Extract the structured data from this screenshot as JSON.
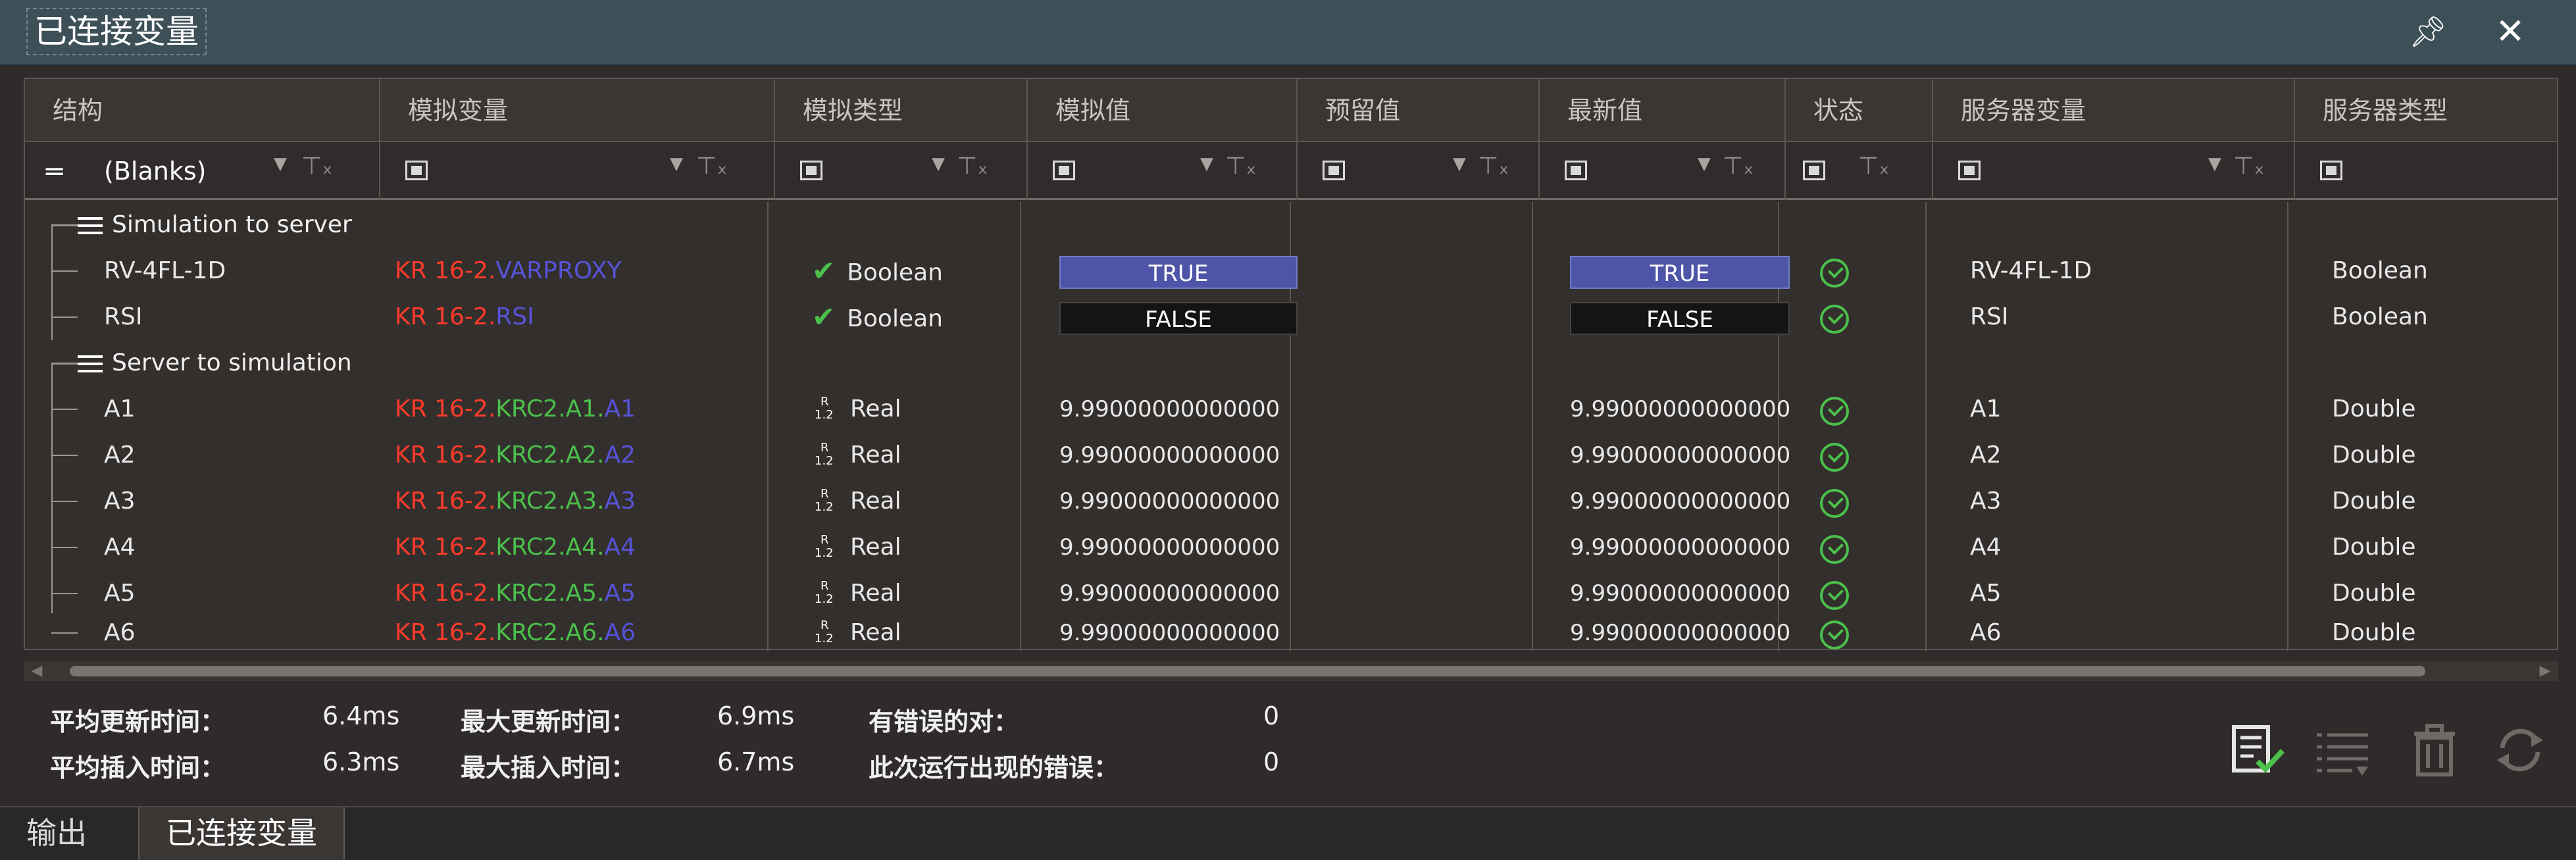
{
  "window": {
    "title": "已连接变量",
    "pin_icon": "pin-icon",
    "close_icon": "close-icon"
  },
  "columns": [
    "结构",
    "模拟变量",
    "模拟类型",
    "模拟值",
    "预留值",
    "最新值",
    "状态",
    "服务器变量",
    "服务器类型"
  ],
  "filter": {
    "structure_value": "(Blanks)"
  },
  "groups": {
    "sim_to_server": "Simulation to server",
    "server_to_sim": "Server to simulation"
  },
  "rows": [
    {
      "name": "RV-4FL-1D",
      "sim_var": [
        "KR 16-2.",
        "",
        "VARPROXY"
      ],
      "sim_type": "Boolean",
      "type_icon": "check",
      "sim_value": "TRUE",
      "latest_value": "TRUE",
      "server_var": "RV-4FL-1D",
      "server_type": "Boolean"
    },
    {
      "name": "RSI",
      "sim_var": [
        "KR 16-2.",
        "",
        "RSI"
      ],
      "sim_type": "Boolean",
      "type_icon": "check",
      "sim_value": "FALSE",
      "latest_value": "FALSE",
      "server_var": "RSI",
      "server_type": "Boolean"
    },
    {
      "name": "A1",
      "sim_var": [
        "KR 16-2.",
        "KRC2.A1.",
        "A1"
      ],
      "sim_type": "Real",
      "type_icon": "real",
      "sim_value": "9.99000000000000",
      "latest_value": "9.990000000000000",
      "server_var": "A1",
      "server_type": "Double"
    },
    {
      "name": "A2",
      "sim_var": [
        "KR 16-2.",
        "KRC2.A2.",
        "A2"
      ],
      "sim_type": "Real",
      "type_icon": "real",
      "sim_value": "9.99000000000000",
      "latest_value": "9.990000000000000",
      "server_var": "A2",
      "server_type": "Double"
    },
    {
      "name": "A3",
      "sim_var": [
        "KR 16-2.",
        "KRC2.A3.",
        "A3"
      ],
      "sim_type": "Real",
      "type_icon": "real",
      "sim_value": "9.99000000000000",
      "latest_value": "9.990000000000000",
      "server_var": "A3",
      "server_type": "Double"
    },
    {
      "name": "A4",
      "sim_var": [
        "KR 16-2.",
        "KRC2.A4.",
        "A4"
      ],
      "sim_type": "Real",
      "type_icon": "real",
      "sim_value": "9.99000000000000",
      "latest_value": "9.990000000000000",
      "server_var": "A4",
      "server_type": "Double"
    },
    {
      "name": "A5",
      "sim_var": [
        "KR 16-2.",
        "KRC2.A5.",
        "A5"
      ],
      "sim_type": "Real",
      "type_icon": "real",
      "sim_value": "9.99000000000000",
      "latest_value": "9.990000000000000",
      "server_var": "A5",
      "server_type": "Double"
    },
    {
      "name": "A6",
      "sim_var": [
        "KR 16-2.",
        "KRC2.A6.",
        "A6"
      ],
      "sim_type": "Real",
      "type_icon": "real",
      "sim_value": "9.99000000000000",
      "latest_value": "9.990000000000000",
      "server_var": "A6",
      "server_type": "Double"
    }
  ],
  "stats": {
    "avg_update_label": "平均更新时间：",
    "avg_update_value": "6.4ms",
    "max_update_label": "最大更新时间：",
    "max_update_value": "6.9ms",
    "error_pairs_label": "有错误的对：",
    "error_pairs_value": "0",
    "avg_insert_label": "平均插入时间：",
    "avg_insert_value": "6.3ms",
    "max_insert_label": "最大插入时间：",
    "max_insert_value": "6.7ms",
    "run_errors_label": "此次运行出现的错误：",
    "run_errors_value": "0"
  },
  "actions": [
    "checklist-icon",
    "list-edit-icon",
    "trash-icon",
    "refresh-icon"
  ],
  "bottom_tabs": [
    {
      "label": "输出"
    },
    {
      "label": "已连接变量"
    }
  ],
  "colors": {
    "titlebar": "#3d5058",
    "true_bg": "#4e55a8",
    "false_bg": "#141414",
    "ok": "#4bc04b",
    "var_red": "#ff3b2a",
    "var_green": "#4bc04b",
    "var_blue": "#5653d8"
  }
}
